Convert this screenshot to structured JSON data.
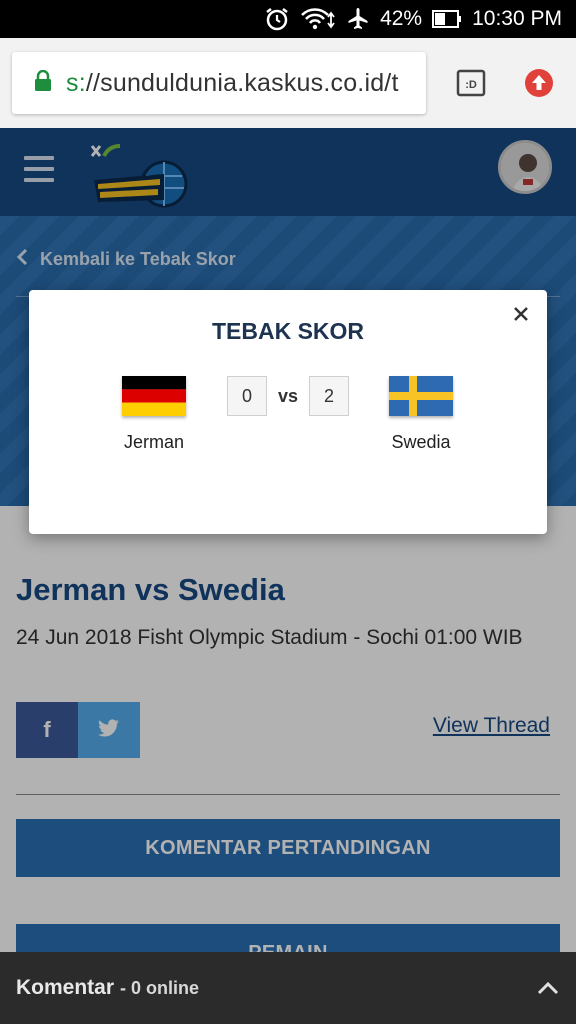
{
  "statusbar": {
    "battery": "42%",
    "time": "10:30 PM",
    "icons": [
      "alarm-icon",
      "wifi-icon",
      "airplane-icon",
      "battery-icon"
    ]
  },
  "browser": {
    "url_scheme": "s:",
    "url_rest": "//sunduldunia.kaskus.co.id/t",
    "tab_label": ":D"
  },
  "hero": {
    "back_label": "Kembali ke Tebak Skor"
  },
  "modal": {
    "title": "TEBAK SKOR",
    "home_team": "Jerman",
    "away_team": "Swedia",
    "home_score": "0",
    "away_score": "2",
    "vs_label": "vs"
  },
  "content": {
    "match_title": "Jerman vs Swedia",
    "match_info": "24 Jun 2018 Fisht Olympic Stadium - Sochi 01:00 WIB",
    "facebook_label": "f",
    "view_thread": "View Thread",
    "btn_comments": "KOMENTAR PERTANDINGAN",
    "btn_players": "PEMAIN"
  },
  "bottombar": {
    "label": "Komentar",
    "online": "- 0 online"
  },
  "colors": {
    "header": "#174a85",
    "hero": "#2a6fb3",
    "facebook": "#3b5998",
    "twitter": "#55acee"
  }
}
